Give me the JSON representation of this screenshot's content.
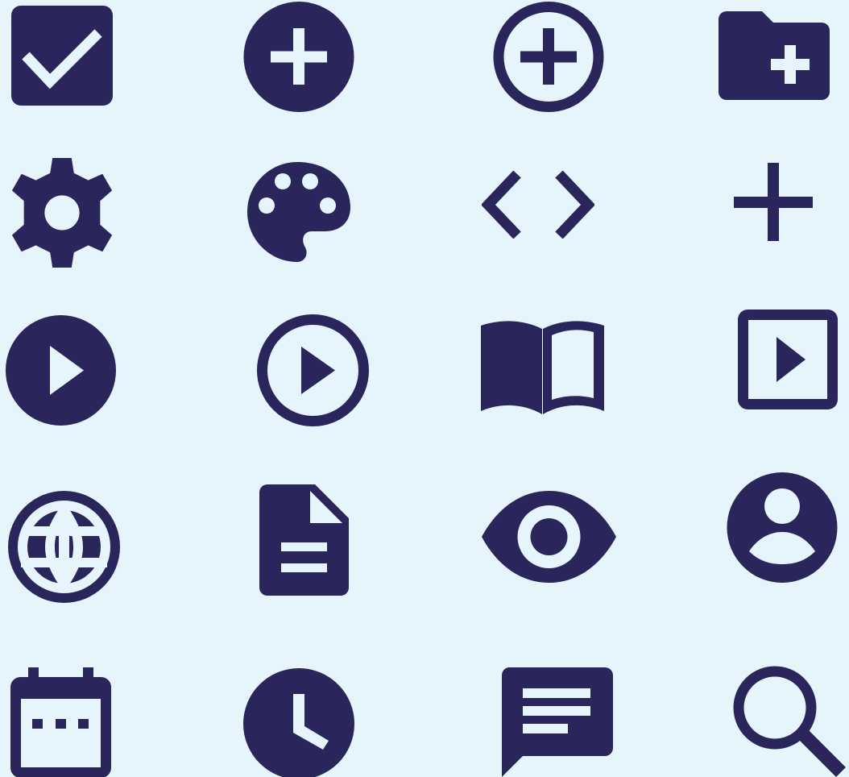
{
  "theme": {
    "background": "#e6f4fc",
    "icon_color": "#2a255b"
  },
  "icons": [
    {
      "name": "checkbox-checked-icon"
    },
    {
      "name": "add-circle-icon"
    },
    {
      "name": "add-circle-outline-icon"
    },
    {
      "name": "create-folder-icon"
    },
    {
      "name": "gear-icon"
    },
    {
      "name": "palette-icon"
    },
    {
      "name": "code-icon"
    },
    {
      "name": "plus-icon"
    },
    {
      "name": "play-circle-icon"
    },
    {
      "name": "play-circle-outline-icon"
    },
    {
      "name": "book-open-icon"
    },
    {
      "name": "slideshow-icon"
    },
    {
      "name": "globe-icon"
    },
    {
      "name": "document-icon"
    },
    {
      "name": "eye-icon"
    },
    {
      "name": "account-circle-icon"
    },
    {
      "name": "calendar-icon"
    },
    {
      "name": "clock-icon"
    },
    {
      "name": "comment-icon"
    },
    {
      "name": "search-icon"
    }
  ]
}
